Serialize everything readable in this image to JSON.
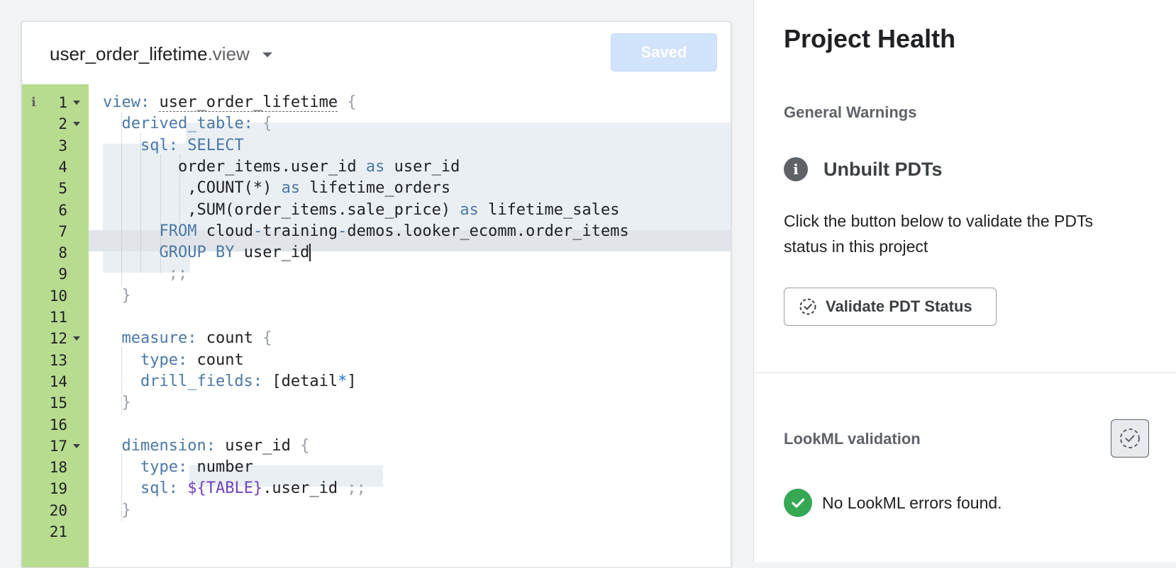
{
  "editor": {
    "file_base": "user_order_lifetime",
    "file_ext": ".view",
    "saved_label": "Saved",
    "line_numbers": [
      "1",
      "2",
      "3",
      "4",
      "5",
      "6",
      "7",
      "8",
      "9",
      "10",
      "11",
      "12",
      "13",
      "14",
      "15",
      "16",
      "17",
      "18",
      "19",
      "20",
      "21"
    ],
    "info_marker": "i",
    "lines": [
      {
        "tokens": [
          [
            "k",
            "view:"
          ],
          [
            "",
            " "
          ],
          [
            "u",
            "user_order_lifetime"
          ],
          [
            "p",
            " {"
          ]
        ]
      },
      {
        "tokens": [
          [
            "",
            "  "
          ],
          [
            "k",
            "derived_table:"
          ],
          [
            "p",
            " {"
          ]
        ]
      },
      {
        "tokens": [
          [
            "",
            "    "
          ],
          [
            "k",
            "sql:"
          ],
          [
            "",
            ""
          ],
          [
            "k",
            " SELECT"
          ]
        ]
      },
      {
        "tokens": [
          [
            "",
            "        order_items.user_id "
          ],
          [
            "k",
            "as"
          ],
          [
            "",
            " user_id"
          ]
        ]
      },
      {
        "tokens": [
          [
            "",
            "         ,COUNT(*) "
          ],
          [
            "k",
            "as"
          ],
          [
            "",
            " lifetime_orders"
          ]
        ]
      },
      {
        "tokens": [
          [
            "",
            "         ,SUM(order_items.sale_price) "
          ],
          [
            "k",
            "as"
          ],
          [
            "",
            " lifetime_sales"
          ]
        ]
      },
      {
        "tokens": [
          [
            "",
            "      "
          ],
          [
            "k",
            "FROM"
          ],
          [
            "",
            " cloud"
          ],
          [
            "k",
            "-"
          ],
          [
            "",
            "training"
          ],
          [
            "k",
            "-"
          ],
          [
            "",
            "demos.looker_ecomm.order_items"
          ]
        ]
      },
      {
        "tokens": [
          [
            "",
            "      "
          ],
          [
            "k",
            "GROUP BY"
          ],
          [
            "",
            " "
          ],
          [
            "c",
            "user_id"
          ]
        ]
      },
      {
        "tokens": [
          [
            "",
            "       "
          ],
          [
            "p",
            ";;"
          ]
        ]
      },
      {
        "tokens": [
          [
            "",
            "  "
          ],
          [
            "p",
            "}"
          ]
        ]
      },
      {
        "tokens": []
      },
      {
        "tokens": [
          [
            "",
            "  "
          ],
          [
            "k",
            "measure:"
          ],
          [
            "",
            " count "
          ],
          [
            "p",
            "{"
          ]
        ]
      },
      {
        "tokens": [
          [
            "",
            "    "
          ],
          [
            "k",
            "type:"
          ],
          [
            "",
            " count"
          ]
        ]
      },
      {
        "tokens": [
          [
            "",
            "    "
          ],
          [
            "k",
            "drill_fields:"
          ],
          [
            "",
            " [detail"
          ],
          [
            "star",
            "*"
          ],
          [
            "",
            "]"
          ]
        ]
      },
      {
        "tokens": [
          [
            "",
            "  "
          ],
          [
            "p",
            "}"
          ]
        ]
      },
      {
        "tokens": []
      },
      {
        "tokens": [
          [
            "",
            "  "
          ],
          [
            "k",
            "dimension:"
          ],
          [
            "",
            " user_id "
          ],
          [
            "p",
            "{"
          ]
        ]
      },
      {
        "tokens": [
          [
            "",
            "    "
          ],
          [
            "k",
            "type:"
          ],
          [
            "",
            " number"
          ]
        ]
      },
      {
        "tokens": [
          [
            "",
            "    "
          ],
          [
            "k",
            "sql:"
          ],
          [
            "",
            " "
          ],
          [
            "v",
            "${TABLE}"
          ],
          [
            "",
            ".user_id "
          ],
          [
            "p",
            ";;"
          ]
        ]
      },
      {
        "tokens": [
          [
            "",
            "  "
          ],
          [
            "p",
            "}"
          ]
        ]
      },
      {
        "tokens": []
      }
    ]
  },
  "panel": {
    "title": "Project Health",
    "general_warnings_label": "General Warnings",
    "warning_title": "Unbuilt PDTs",
    "warning_description": "Click the button below to validate the PDTs status in this project",
    "validate_button_label": "Validate PDT Status",
    "lookml_validation_label": "LookML validation",
    "lookml_status": "No LookML errors found."
  },
  "colors": {
    "gutter": "#b7dc8f",
    "saved_button": "#d2e3fc",
    "success": "#34a853",
    "keyword": "#4a78a8"
  },
  "icons": [
    "chevron-down-icon",
    "info-icon",
    "fold-arrow-icon",
    "dashed-check-circle-icon",
    "check-circle-icon"
  ]
}
